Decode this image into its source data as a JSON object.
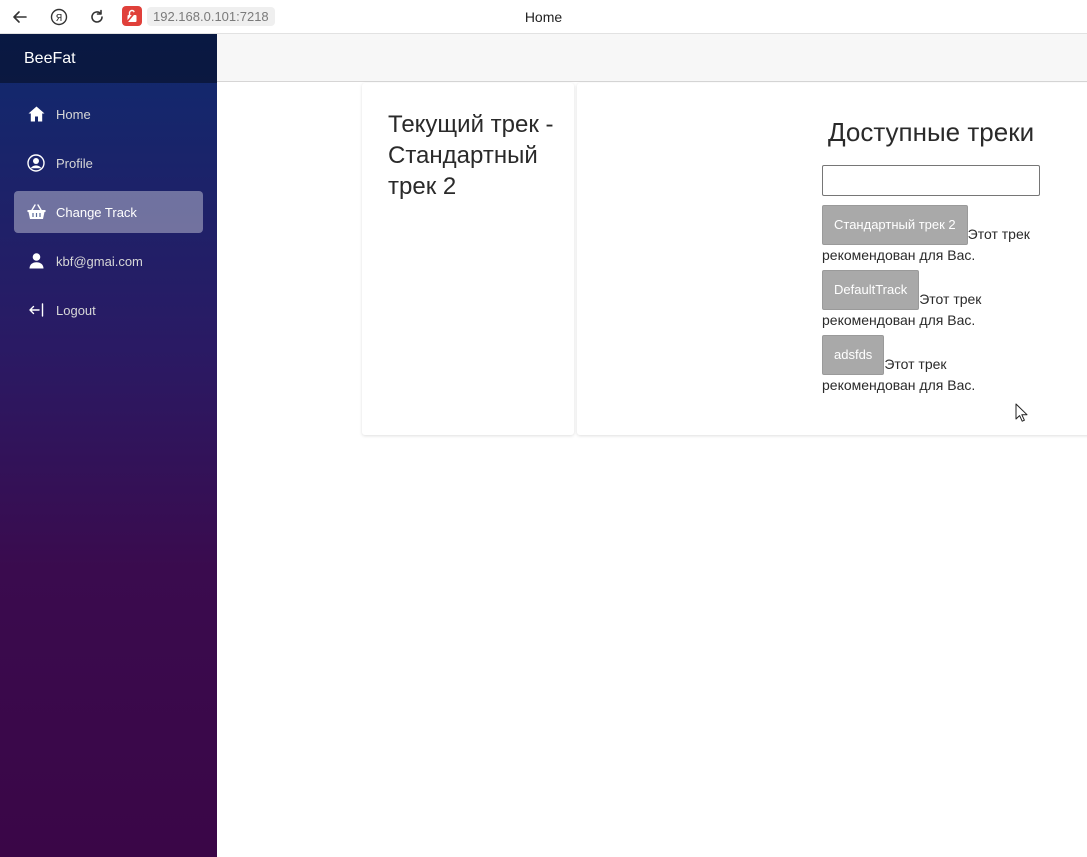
{
  "browser": {
    "url": "192.168.0.101:7218",
    "tab_title": "Home"
  },
  "sidebar": {
    "brand": "BeeFat",
    "items": [
      {
        "label": "Home",
        "icon": "home-icon"
      },
      {
        "label": "Profile",
        "icon": "profile-icon"
      },
      {
        "label": "Change Track",
        "icon": "basket-icon",
        "active": true
      },
      {
        "label": "kbf@gmai.com",
        "icon": "user-icon"
      },
      {
        "label": "Logout",
        "icon": "logout-icon"
      }
    ]
  },
  "current": {
    "title": "Текущий трек - Стандартный трек 2"
  },
  "available": {
    "title": "Доступные треки",
    "search_value": "",
    "tracks": [
      {
        "name": "Стандартный трек 2",
        "note": "Этот трек рекомендован для Вас."
      },
      {
        "name": "DefaultTrack",
        "note": "Этот трек рекомендован для Вас."
      },
      {
        "name": "adsfds",
        "note": "Этот трек рекомендован для Вас."
      }
    ]
  },
  "colors": {
    "sidebar_top": "#0f2a6e",
    "sidebar_bottom": "#3a0647",
    "track_button": "#a9a9a9",
    "lock_badge": "#e0403a"
  }
}
